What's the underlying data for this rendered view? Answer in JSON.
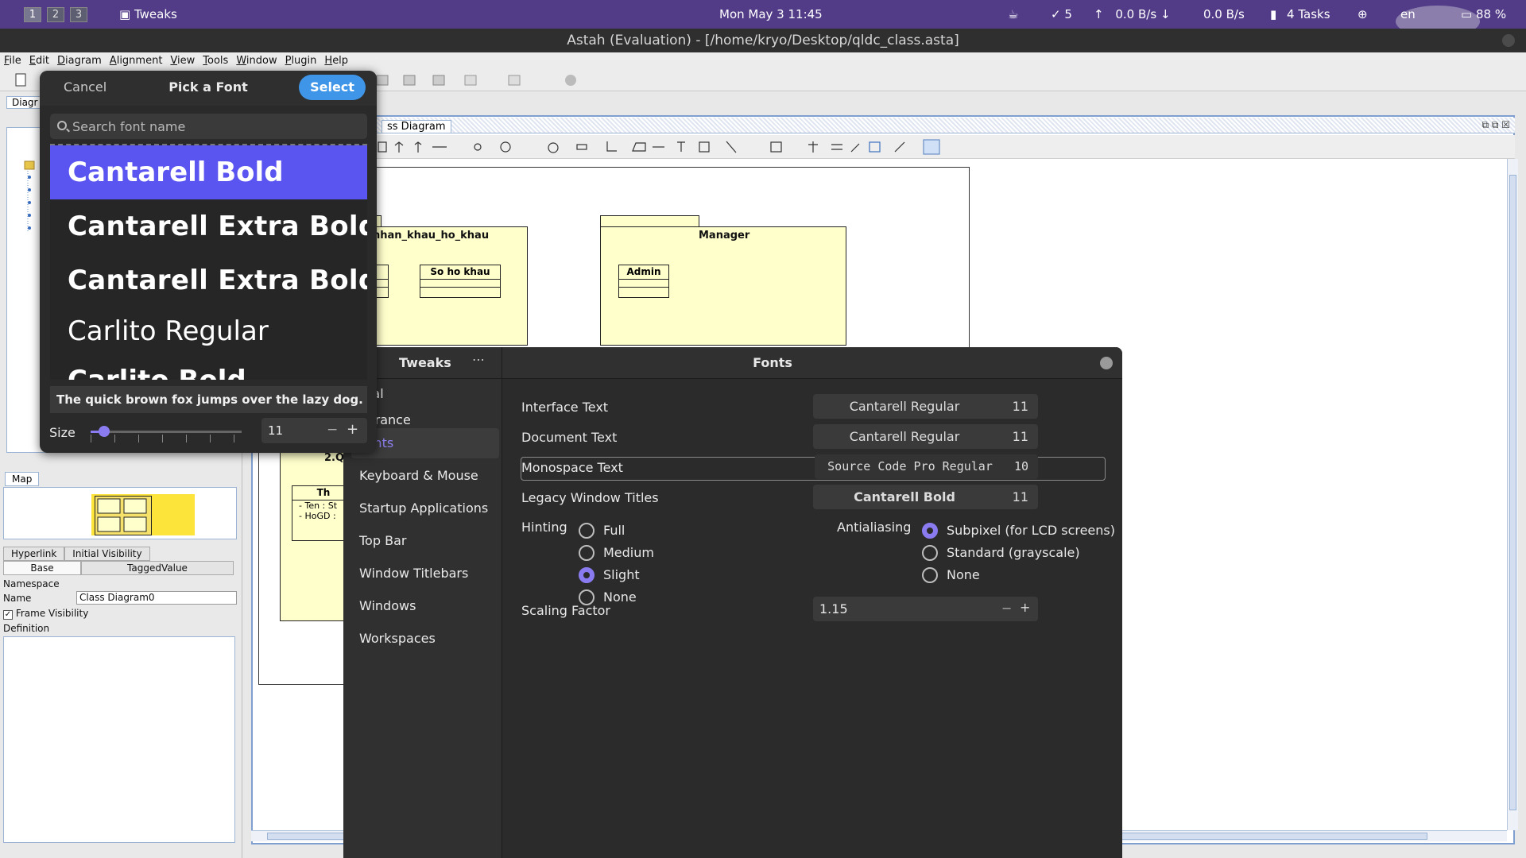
{
  "topbar": {
    "workspaces": [
      "1",
      "2",
      "3"
    ],
    "app_name": "Tweaks",
    "datetime": "Mon May 3  11:45",
    "updates": "5",
    "net_up": "0.0 B/s",
    "net_down": "0.0 B/s",
    "tasks": "4 Tasks",
    "language": "en",
    "battery": "88 %"
  },
  "astah": {
    "title": "Astah (Evaluation) - [/home/kryo/Desktop/qldc_class.asta]",
    "menu": [
      "File",
      "Edit",
      "Diagram",
      "Alignment",
      "View",
      "Tools",
      "Window",
      "Plugin",
      "Help"
    ],
    "diagram_tab": "ss Diagram",
    "left_tab_partial": "Diagr",
    "map_tab": "Map",
    "prop_tabs_row1": [
      "Hyperlink",
      "Initial Visibility"
    ],
    "prop_tabs_row2": [
      "Base",
      "TaggedValue"
    ],
    "namespace_label": "Namespace",
    "name_label": "Name",
    "name_value": "Class Diagram0",
    "frame_visibility": "Frame Visibility",
    "definition_label": "Definition",
    "packages": {
      "nhan_khau": "nhan_khau_ho_khau",
      "so_ho_khau": "So ho khau",
      "manager": "Manager",
      "admin": "Admin",
      "pkg_partial": "2.Q",
      "class_partial": "Th",
      "attr1": "- Ten : St",
      "attr2": "- HoGD :"
    }
  },
  "tweaks": {
    "window_title_left": "Tweaks",
    "header_menu": "⋯",
    "title": "Fonts",
    "sidebar": [
      {
        "label": "eral"
      },
      {
        "label": "earance"
      },
      {
        "label": "Fonts",
        "selected": true
      },
      {
        "label": "Keyboard & Mouse"
      },
      {
        "label": "Startup Applications"
      },
      {
        "label": "Top Bar"
      },
      {
        "label": "Window Titlebars"
      },
      {
        "label": "Windows"
      },
      {
        "label": "Workspaces"
      }
    ],
    "fonts": {
      "interface": {
        "label": "Interface Text",
        "font": "Cantarell Regular",
        "size": "11"
      },
      "document": {
        "label": "Document Text",
        "font": "Cantarell Regular",
        "size": "11"
      },
      "monospace": {
        "label": "Monospace Text",
        "font": "Source Code Pro Regular",
        "size": "10"
      },
      "legacy": {
        "label": "Legacy Window Titles",
        "font": "Cantarell Bold",
        "size": "11"
      }
    },
    "hinting": {
      "label": "Hinting",
      "options": [
        "Full",
        "Medium",
        "Slight",
        "None"
      ],
      "selected": "Slight"
    },
    "antialiasing": {
      "label": "Antialiasing",
      "options": [
        "Subpixel (for LCD screens)",
        "Standard (grayscale)",
        "None"
      ],
      "selected": "Subpixel (for LCD screens)"
    },
    "scaling": {
      "label": "Scaling Factor",
      "value": "1.15",
      "minus": "−",
      "plus": "+"
    }
  },
  "font_picker": {
    "cancel": "Cancel",
    "title": "Pick a Font",
    "select": "Select",
    "search_placeholder": "Search font name",
    "items": [
      {
        "label": "Cantarell Bold",
        "selected": true
      },
      {
        "label": "Cantarell Extra Bold"
      },
      {
        "label": "Cantarell Extra Bold"
      },
      {
        "label": "Carlito Regular"
      },
      {
        "label": "Carlito Bold"
      }
    ],
    "preview": "The quick brown fox jumps over the lazy dog.",
    "size_label": "Size",
    "size_value": "11",
    "size_fraction": 0.05,
    "minus": "−",
    "plus": "+"
  },
  "colors": {
    "topbar": "#523c88",
    "accent": "#8a7cf0",
    "select_button": "#3f96e8",
    "selected_font": "#5a55f0",
    "uml_fill": "#ffffcc"
  }
}
